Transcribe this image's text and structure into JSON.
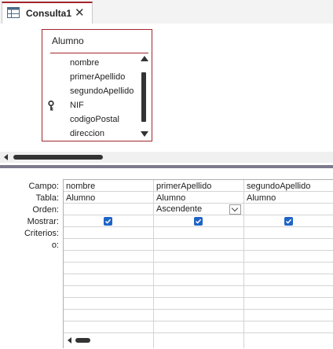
{
  "tab": {
    "label": "Consulta1",
    "close": "✕"
  },
  "table_box": {
    "title": "Alumno",
    "fields": [
      {
        "name": "nombre",
        "key": false
      },
      {
        "name": "primerApellido",
        "key": false
      },
      {
        "name": "segundoApellido",
        "key": false
      },
      {
        "name": "NIF",
        "key": true
      },
      {
        "name": "codigoPostal",
        "key": false
      },
      {
        "name": "direccion",
        "key": false
      }
    ]
  },
  "grid": {
    "row_labels": [
      "Campo:",
      "Tabla:",
      "Orden:",
      "Mostrar:",
      "Criterios:",
      "o:"
    ],
    "columns": [
      {
        "campo": "nombre",
        "tabla": "Alumno",
        "orden": "",
        "mostrar": true
      },
      {
        "campo": "primerApellido",
        "tabla": "Alumno",
        "orden": "Ascendente",
        "mostrar": true
      },
      {
        "campo": "segundoApellido",
        "tabla": "Alumno",
        "orden": "",
        "mostrar": true
      }
    ]
  },
  "colors": {
    "accent": "#a4262c",
    "checkbox": "#1f64c7",
    "splitter": "#7d7a8e"
  },
  "icons": {
    "tab": "query-icon",
    "key": "key-icon"
  }
}
